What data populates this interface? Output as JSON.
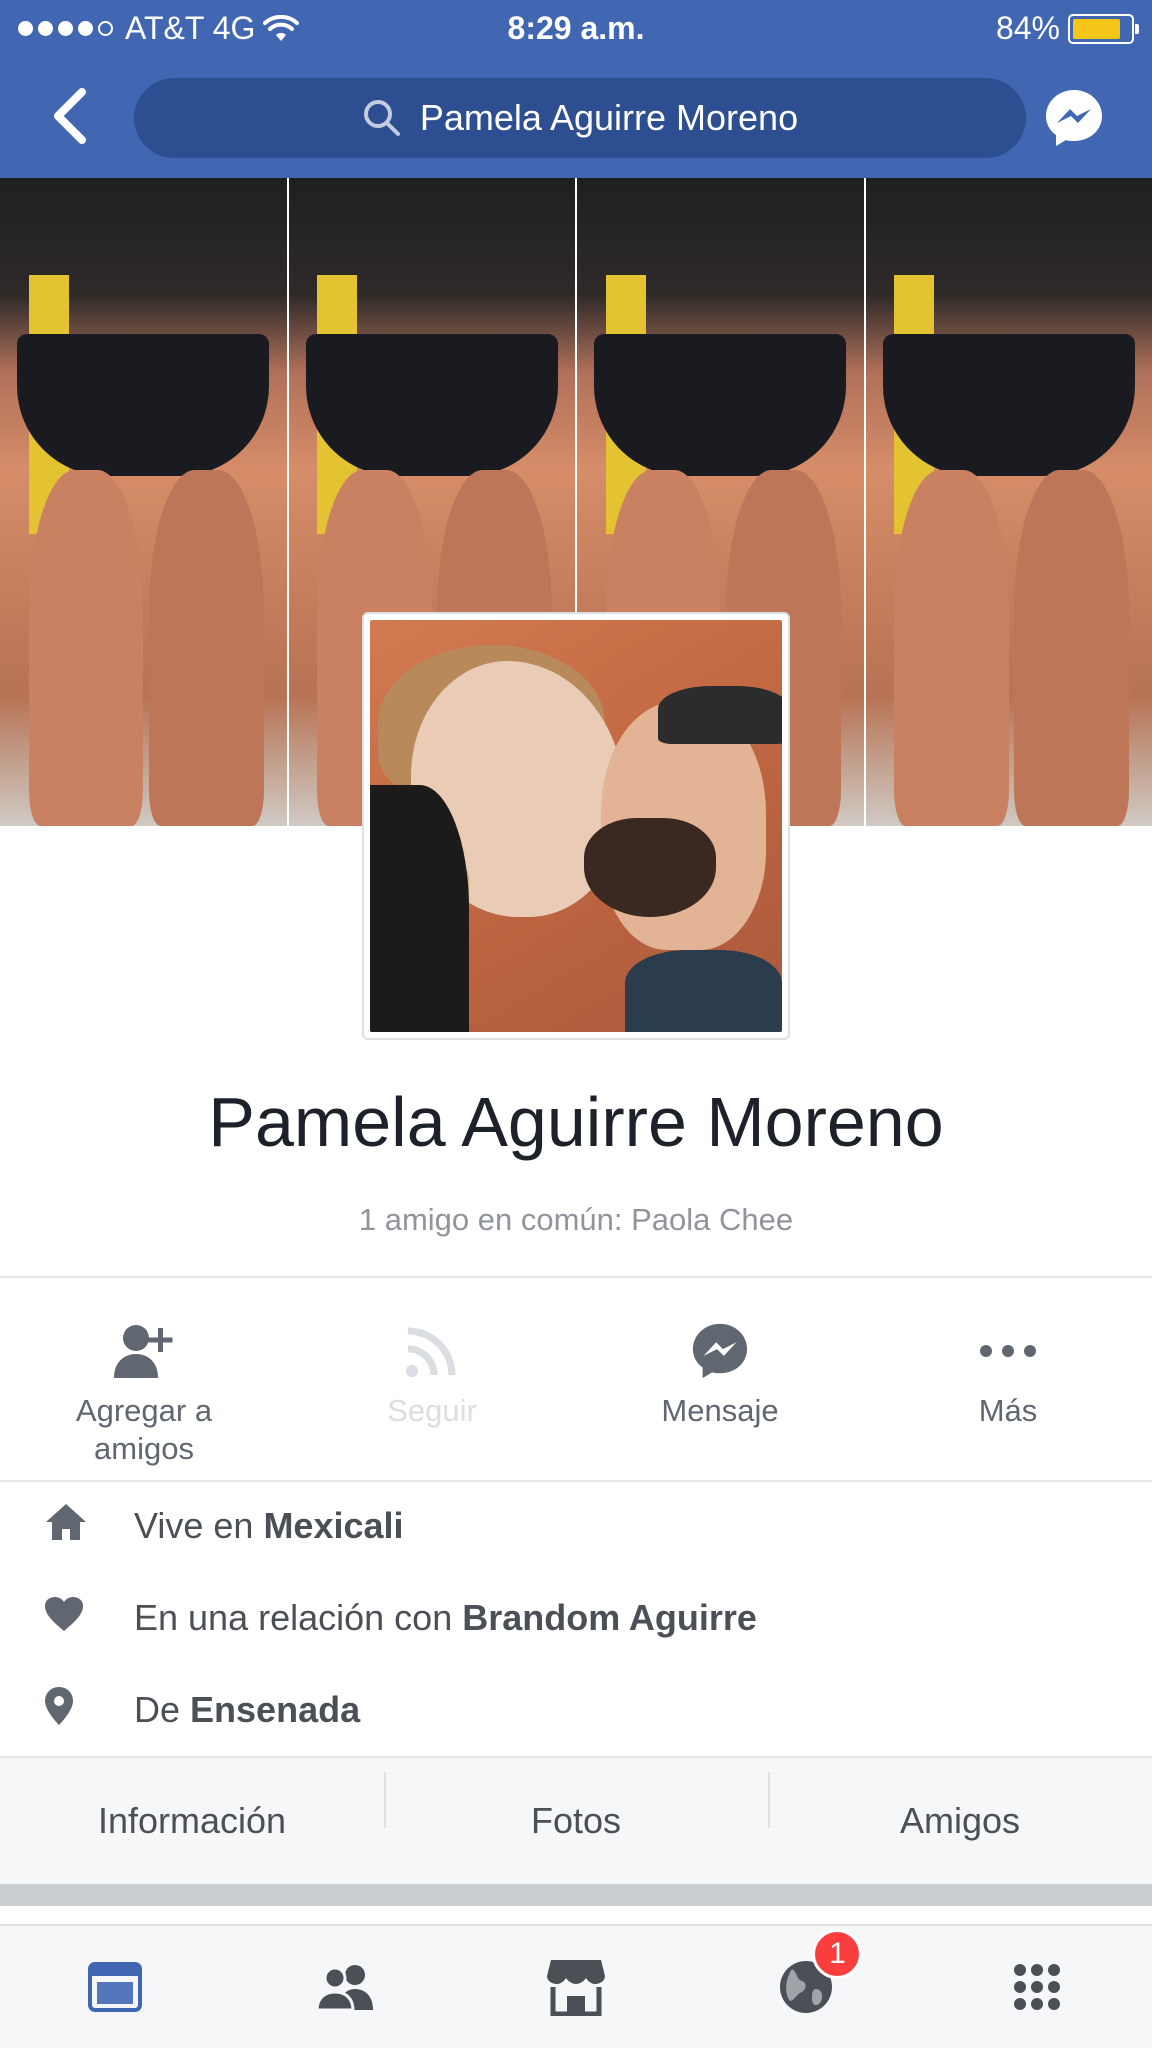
{
  "status_bar": {
    "carrier": "AT&T 4G",
    "time": "8:29 a.m.",
    "battery": "84%",
    "battery_level": 0.84
  },
  "nav": {
    "search_text": "Pamela Aguirre Moreno"
  },
  "profile": {
    "name": "Pamela Aguirre Moreno",
    "mutual_friends": "1 amigo en común: Paola Chee"
  },
  "actions": [
    {
      "label": "Agregar a amigos",
      "icon": "add-friend-icon",
      "enabled": true
    },
    {
      "label": "Seguir",
      "icon": "follow-icon",
      "enabled": false
    },
    {
      "label": "Mensaje",
      "icon": "messenger-icon",
      "enabled": true
    },
    {
      "label": "Más",
      "icon": "more-icon",
      "enabled": true
    }
  ],
  "info": [
    {
      "icon": "home-icon",
      "prefix": "Vive en ",
      "value": "Mexicali"
    },
    {
      "icon": "heart-icon",
      "prefix": "En una relación con ",
      "value": "Brandom Aguirre"
    },
    {
      "icon": "location-pin-icon",
      "prefix": "De ",
      "value": "Ensenada"
    }
  ],
  "tabs": [
    "Información",
    "Fotos",
    "Amigos"
  ],
  "bottom_bar": [
    {
      "icon": "news-feed-icon",
      "active": true
    },
    {
      "icon": "friend-requests-icon",
      "active": false
    },
    {
      "icon": "marketplace-icon",
      "active": false
    },
    {
      "icon": "notifications-globe-icon",
      "active": false,
      "badge": "1"
    },
    {
      "icon": "menu-grid-icon",
      "active": false
    }
  ],
  "colors": {
    "brand": "#4267b2",
    "active_tab": "#4267b2",
    "inactive_icon": "#4b4f56",
    "badge": "#fa3e3e",
    "battery": "#f5c518"
  }
}
